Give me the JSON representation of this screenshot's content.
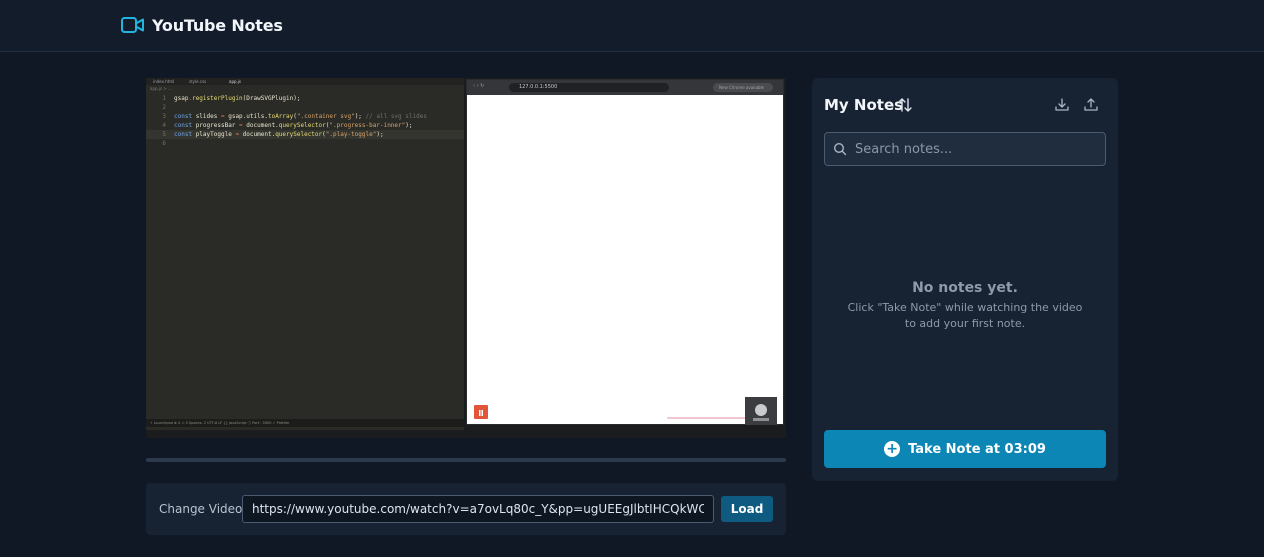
{
  "app": {
    "title": "YouTube Notes"
  },
  "video": {
    "editor_tabs": [
      "index.html",
      "style.css",
      "app.js"
    ],
    "editor_path": "app.js > ...",
    "code_lines": [
      {
        "n": "1",
        "tokens": [
          [
            "var",
            "gsap"
          ],
          [
            "op",
            "."
          ],
          [
            "fn",
            "registerPlugin"
          ],
          [
            "var",
            "(DrawSVGPlugin);"
          ]
        ]
      },
      {
        "n": "2",
        "tokens": []
      },
      {
        "n": "3",
        "tokens": [
          [
            "kw",
            "const "
          ],
          [
            "var",
            "slides "
          ],
          [
            "op",
            "= "
          ],
          [
            "var",
            "gsap.utils."
          ],
          [
            "fn",
            "toArray"
          ],
          [
            "var",
            "("
          ],
          [
            "str",
            "\".container svg\""
          ],
          [
            "var",
            "); "
          ],
          [
            "cm",
            "// all svg slides"
          ]
        ]
      },
      {
        "n": "4",
        "tokens": [
          [
            "kw",
            "const "
          ],
          [
            "var",
            "progressBar "
          ],
          [
            "op",
            "= "
          ],
          [
            "var",
            "document."
          ],
          [
            "fn",
            "querySelector"
          ],
          [
            "var",
            "("
          ],
          [
            "str",
            "\".progress-bar-inner\""
          ],
          [
            "var",
            ");"
          ]
        ]
      },
      {
        "n": "5",
        "tokens": [
          [
            "kw",
            "const "
          ],
          [
            "var",
            "playToggle "
          ],
          [
            "op",
            "= "
          ],
          [
            "var",
            "document."
          ],
          [
            "fn",
            "querySelector"
          ],
          [
            "var",
            "("
          ],
          [
            "str",
            "\".play-toggle\""
          ],
          [
            "var",
            ");"
          ]
        ]
      },
      {
        "n": "6",
        "tokens": []
      }
    ],
    "editor_status": "⚡ Launchpad   ⊗ 0 ⚠ 0   Spaces: 2   UTF-8   LF   {} JavaScript   ⓘ Port : 5500   ✓ Prettier",
    "browser_url": "127.0.0.1:5500",
    "browser_update": "New Chrome available"
  },
  "change_video": {
    "label": "Change Video:",
    "url": "https://www.youtube.com/watch?v=a7ovLq80c_Y&pp=ugUEEgJlbtIHCQkWCgGHKiGM7",
    "load_label": "Load"
  },
  "notes": {
    "title": "My Notes",
    "search_placeholder": "Search notes...",
    "empty_title": "No notes yet.",
    "empty_hint": "Click \"Take Note\" while watching the video to add your first note.",
    "take_note_label": "Take Note at 03:09"
  },
  "colors": {
    "accent": "#0c87b5",
    "brand_icon": "#22b5e0",
    "load_button": "#0f5a80"
  }
}
